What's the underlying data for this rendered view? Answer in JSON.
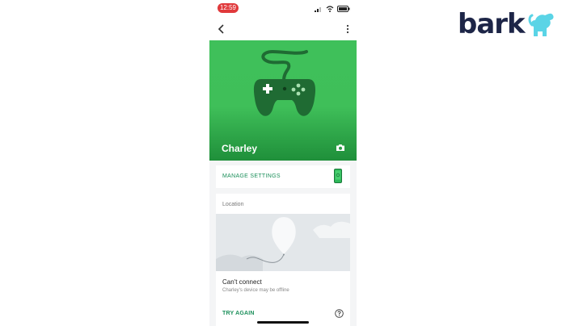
{
  "status_bar": {
    "time": "12:59"
  },
  "app_bar": {
    "back_icon": "chevron-left-icon",
    "more_icon": "more-vertical-icon"
  },
  "profile": {
    "name": "Charley",
    "avatar_icon": "game-controller-icon",
    "camera_icon": "camera-icon"
  },
  "manage": {
    "label": "MANAGE SETTINGS",
    "icon": "phone-settings-icon"
  },
  "location": {
    "label": "Location",
    "status_title": "Can't connect",
    "status_detail": "Charley's device may be offline",
    "action_label": "TRY AGAIN",
    "help_icon": "help-icon"
  },
  "brand": {
    "logo_text": "bark",
    "accent": "#1d2547",
    "dog_color": "#5ad4e6"
  },
  "colors": {
    "hero_green": "#3fc05a",
    "link_green": "#1b8f5a",
    "status_red": "#e0393b"
  }
}
